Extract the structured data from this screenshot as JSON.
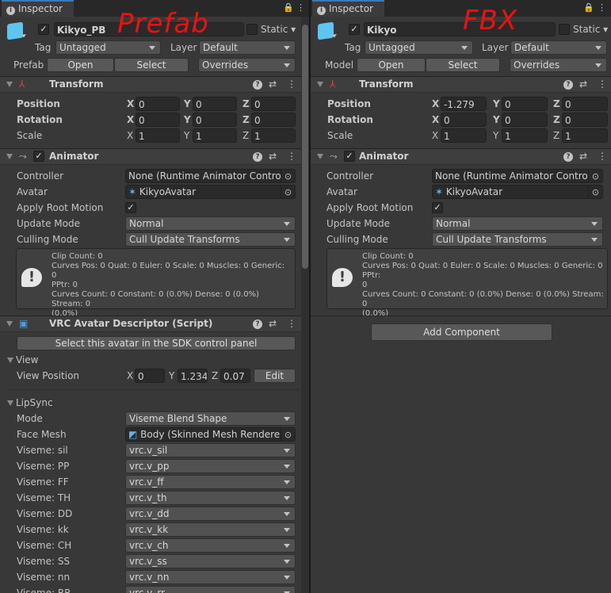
{
  "tab_label": "Inspector",
  "annotations": {
    "left": "Prefab",
    "right": "FBX"
  },
  "colors": {
    "accent": "#3a79bb",
    "annotation": "#ee1111",
    "background": "#383838"
  },
  "left": {
    "object_name": "Kikyo_PB",
    "static_label": "Static",
    "tag_label": "Tag",
    "tag_value": "Untagged",
    "layer_label": "Layer",
    "layer_value": "Default",
    "prefab_label": "Prefab",
    "open_label": "Open",
    "select_label": "Select",
    "overrides_label": "Overrides",
    "transform": {
      "title": "Transform",
      "position_label": "Position",
      "rotation_label": "Rotation",
      "scale_label": "Scale",
      "position": [
        "0",
        "0",
        "0"
      ],
      "rotation": [
        "0",
        "0",
        "0"
      ],
      "scale": [
        "1",
        "1",
        "1"
      ]
    },
    "animator": {
      "title": "Animator",
      "controller_label": "Controller",
      "controller_value": "None (Runtime Animator Controller)",
      "avatar_label": "Avatar",
      "avatar_value": "KikyoAvatar",
      "apply_root_motion_label": "Apply Root Motion",
      "apply_root_motion": true,
      "update_mode_label": "Update Mode",
      "update_mode_value": "Normal",
      "culling_mode_label": "Culling Mode",
      "culling_mode_value": "Cull Update Transforms",
      "info_lines": [
        "Clip Count: 0",
        "Curves Pos: 0 Quat: 0 Euler: 0 Scale: 0 Muscles: 0 Generic: 0",
        "PPtr: 0",
        "Curves Count: 0 Constant: 0 (0.0%) Dense: 0 (0.0%) Stream: 0",
        "(0.0%)"
      ]
    },
    "vrc": {
      "title": "VRC Avatar Descriptor (Script)",
      "sdk_button": "Select this avatar in the SDK control panel",
      "view_section": "View",
      "view_position_label": "View Position",
      "view_position": [
        "0",
        "1.234",
        "0.07"
      ],
      "edit_label": "Edit",
      "lipsync_section": "LipSync",
      "mode_label": "Mode",
      "mode_value": "Viseme Blend Shape",
      "face_mesh_label": "Face Mesh",
      "face_mesh_value": "Body (Skinned Mesh Renderer)",
      "visemes": [
        {
          "label": "Viseme: sil",
          "value": "vrc.v_sil"
        },
        {
          "label": "Viseme: PP",
          "value": "vrc.v_pp"
        },
        {
          "label": "Viseme: FF",
          "value": "vrc.v_ff"
        },
        {
          "label": "Viseme: TH",
          "value": "vrc.v_th"
        },
        {
          "label": "Viseme: DD",
          "value": "vrc.v_dd"
        },
        {
          "label": "Viseme: kk",
          "value": "vrc.v_kk"
        },
        {
          "label": "Viseme: CH",
          "value": "vrc.v_ch"
        },
        {
          "label": "Viseme: SS",
          "value": "vrc.v_ss"
        },
        {
          "label": "Viseme: nn",
          "value": "vrc.v_nn"
        },
        {
          "label": "Viseme: RR",
          "value": "vrc.v_rr"
        }
      ]
    }
  },
  "right": {
    "object_name": "Kikyo",
    "static_label": "Static",
    "tag_label": "Tag",
    "tag_value": "Untagged",
    "layer_label": "Layer",
    "layer_value": "Default",
    "model_label": "Model",
    "open_label": "Open",
    "select_label": "Select",
    "overrides_label": "Overrides",
    "transform": {
      "title": "Transform",
      "position_label": "Position",
      "rotation_label": "Rotation",
      "scale_label": "Scale",
      "position": [
        "-1.279",
        "0",
        "0"
      ],
      "rotation": [
        "0",
        "0",
        "0"
      ],
      "scale": [
        "1",
        "1",
        "1"
      ]
    },
    "animator": {
      "title": "Animator",
      "controller_label": "Controller",
      "controller_value": "None (Runtime Animator Controller)",
      "avatar_label": "Avatar",
      "avatar_value": "KikyoAvatar",
      "apply_root_motion_label": "Apply Root Motion",
      "apply_root_motion": true,
      "update_mode_label": "Update Mode",
      "update_mode_value": "Normal",
      "culling_mode_label": "Culling Mode",
      "culling_mode_value": "Cull Update Transforms",
      "info_lines": [
        "Clip Count: 0",
        "Curves Pos: 0 Quat: 0 Euler: 0 Scale: 0 Muscles: 0 Generic: 0 PPtr:",
        "0",
        "Curves Count: 0 Constant: 0 (0.0%) Dense: 0 (0.0%) Stream: 0",
        "(0.0%)"
      ]
    },
    "add_component_label": "Add Component"
  },
  "axes": {
    "x": "X",
    "y": "Y",
    "z": "Z"
  }
}
